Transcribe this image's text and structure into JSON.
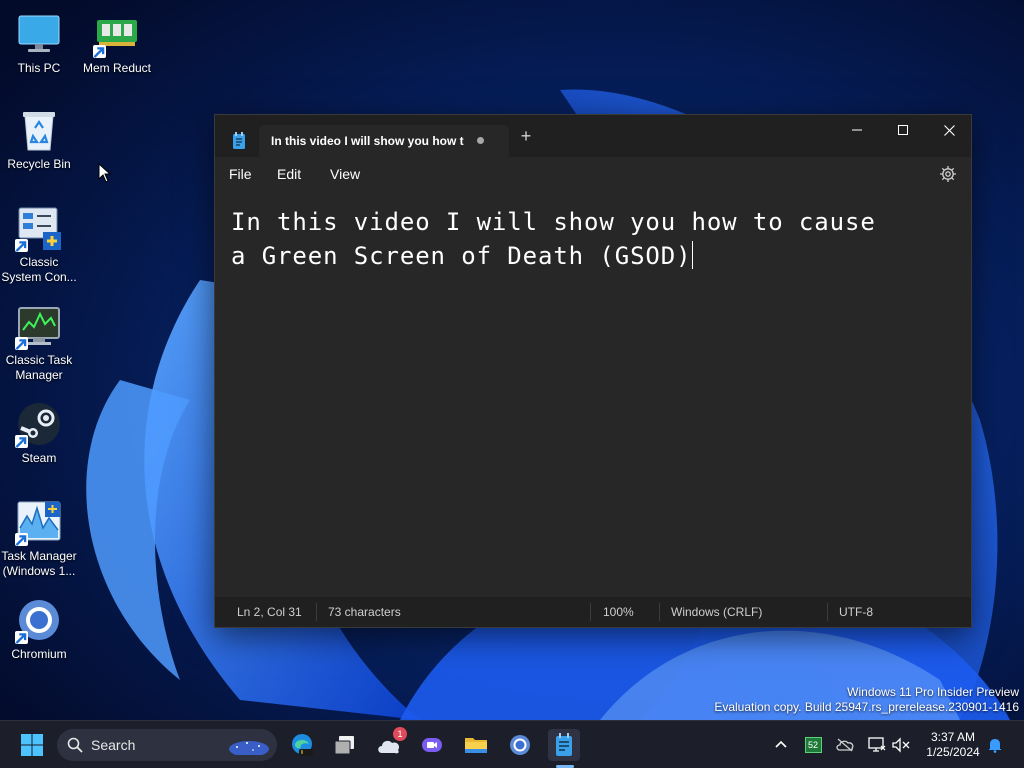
{
  "desktop": {
    "icons": [
      {
        "label": "This PC"
      },
      {
        "label": "Mem Reduct"
      },
      {
        "label": "Recycle Bin"
      },
      {
        "label": "Classic System Con..."
      },
      {
        "label": "Classic Task Manager"
      },
      {
        "label": "Steam"
      },
      {
        "label": "Task Manager (Windows 1..."
      },
      {
        "label": "Chromium"
      }
    ]
  },
  "notepad": {
    "tab_title": "In this video I will show you how t",
    "new_tab_glyph": "+",
    "menu": {
      "file": "File",
      "edit": "Edit",
      "view": "View"
    },
    "content": {
      "line1": "In this video I will show you how to cause",
      "line2": "a Green Screen of Death (GSOD)"
    },
    "status": {
      "position": "Ln 2, Col 31",
      "characters": "73 characters",
      "zoom": "100%",
      "line_ending": "Windows (CRLF)",
      "encoding": "UTF-8"
    }
  },
  "watermark": {
    "line1": "Windows 11 Pro Insider Preview",
    "line2": "Evaluation copy. Build 25947.rs_prerelease.230901-1416"
  },
  "taskbar": {
    "search_label": "Search",
    "weather_badge": "1",
    "time": "3:37 AM",
    "date": "1/25/2024",
    "tray_badge": "52"
  },
  "colors": {
    "accent": "#0a5fff",
    "window_bg": "#272727",
    "titlebar_bg": "#202020",
    "taskbar_bg": "#1c1f2a"
  }
}
